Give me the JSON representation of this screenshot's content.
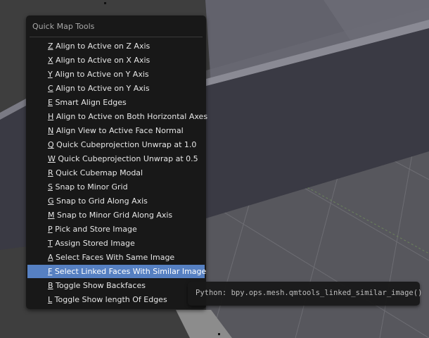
{
  "menu": {
    "title": "Quick Map Tools",
    "items": [
      {
        "key": "Z",
        "label": "Align to Active on Z Axis",
        "active": false
      },
      {
        "key": "X",
        "label": "Align to Active on X Axis",
        "active": false
      },
      {
        "key": "Y",
        "label": "Align to Active on Y Axis",
        "active": false
      },
      {
        "key": "C",
        "label": "Align to Active on Y Axis",
        "active": false
      },
      {
        "key": "E",
        "label": "Smart Align Edges",
        "active": false
      },
      {
        "key": "H",
        "label": "Align to Active on Both Horizontal Axes",
        "active": false
      },
      {
        "key": "N",
        "label": "Align View to Active Face Normal",
        "active": false
      },
      {
        "key": "Q",
        "label": "Quick Cubeprojection Unwrap at 1.0",
        "active": false
      },
      {
        "key": "W",
        "label": "Quick Cubeprojection Unwrap at 0.5",
        "active": false
      },
      {
        "key": "R",
        "label": "Quick Cubemap Modal",
        "active": false
      },
      {
        "key": "S",
        "label": "Snap to Minor Grid",
        "active": false
      },
      {
        "key": "G",
        "label": "Snap to Grid Along Axis",
        "active": false
      },
      {
        "key": "M",
        "label": "Snap to Minor Grid Along Axis",
        "active": false
      },
      {
        "key": "P",
        "label": "Pick and Store Image",
        "active": false
      },
      {
        "key": "T",
        "label": "Assign Stored Image",
        "active": false
      },
      {
        "key": "A",
        "label": "Select Faces With Same Image",
        "active": false
      },
      {
        "key": "F",
        "label": "Select Linked Faces With Similar Image",
        "active": true
      },
      {
        "key": "B",
        "label": "Toggle Show Backfaces",
        "active": false
      },
      {
        "key": "L",
        "label": "Toggle Show length Of Edges",
        "active": false
      }
    ]
  },
  "tooltip": {
    "text": "Python: bpy.ops.mesh.qmtools_linked_similar_image()"
  },
  "colors": {
    "viewport_bg": "#3d3d3d",
    "menu_bg": "#171717",
    "highlight": "#5680c2",
    "grid_line": "#6f6f6f",
    "y_axis_line": "#6a9c3c",
    "mesh_light": "#6d6d77",
    "mesh_dark": "#3b3b45"
  }
}
